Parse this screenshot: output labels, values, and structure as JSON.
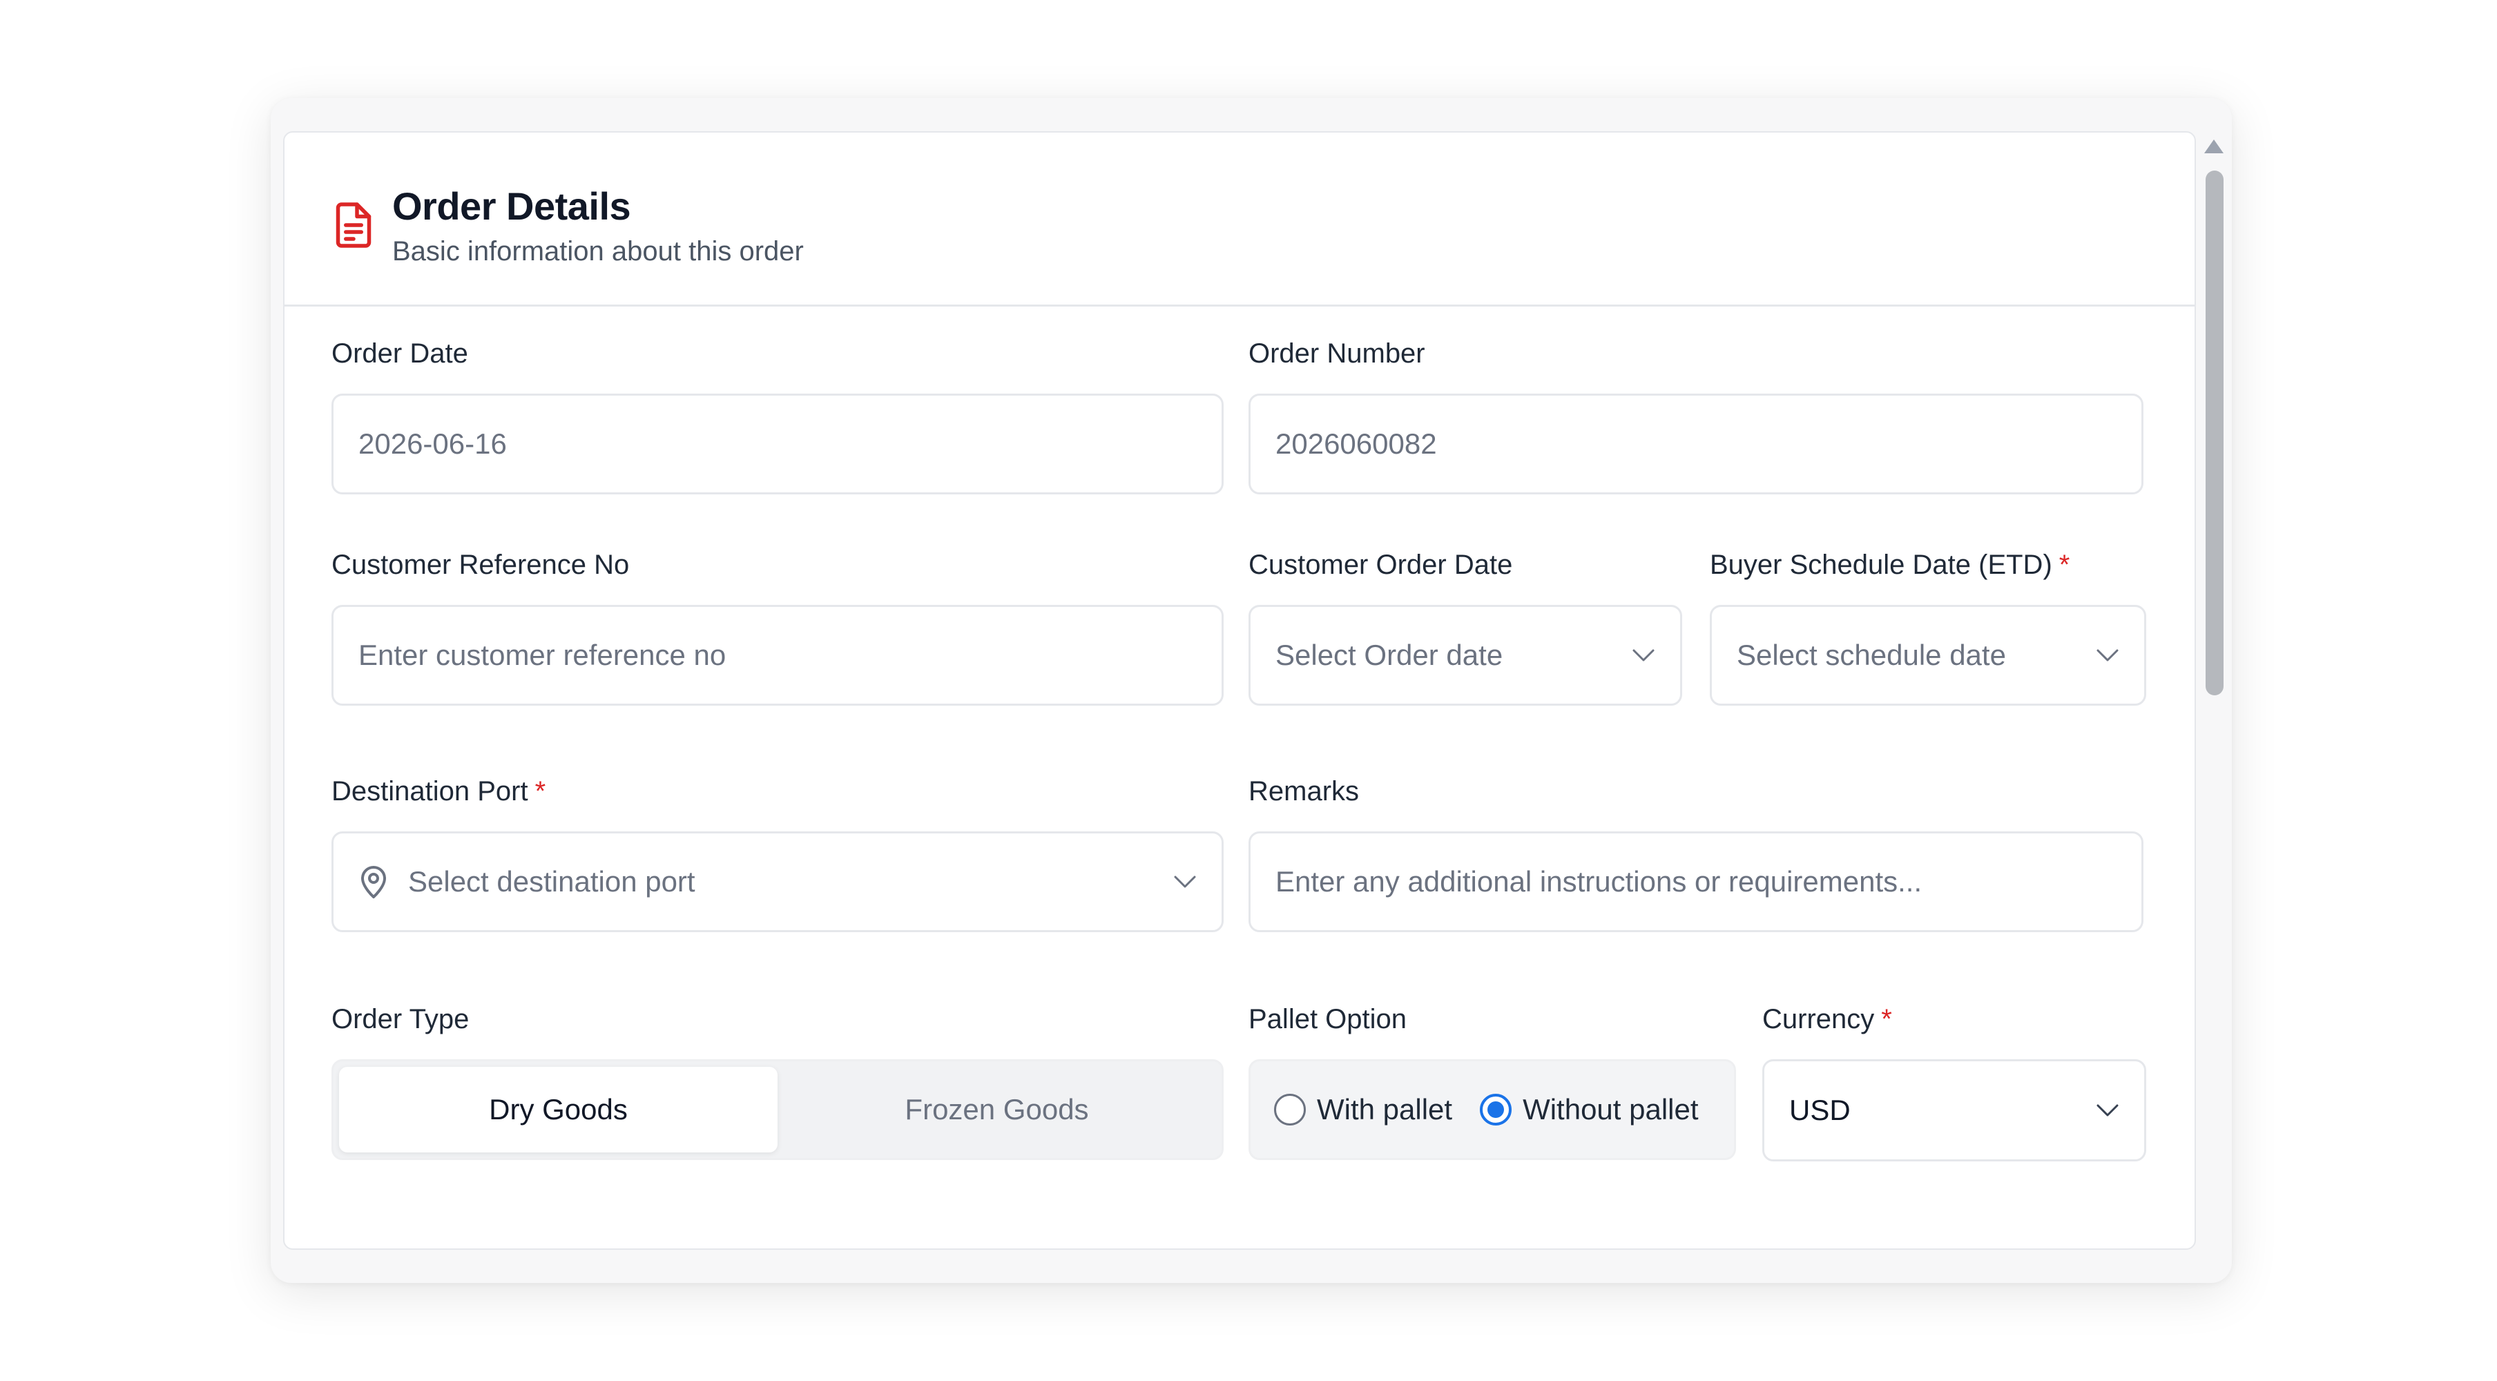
{
  "header": {
    "icon": "document-icon",
    "title": "Order Details",
    "subtitle": "Basic information about this order"
  },
  "order_date": {
    "label": "Order Date",
    "value": "2026-06-16"
  },
  "order_number": {
    "label": "Order Number",
    "value": "2026060082"
  },
  "customer_reference": {
    "label": "Customer Reference No",
    "placeholder": "Enter customer reference no"
  },
  "customer_order_date": {
    "label": "Customer Order Date",
    "placeholder": "Select Order date"
  },
  "buyer_schedule_date": {
    "label": "Buyer Schedule Date (ETD)",
    "required": "*",
    "placeholder": "Select schedule date"
  },
  "destination_port": {
    "label": "Destination Port",
    "required": "*",
    "placeholder": "Select destination port",
    "icon": "map-pin-icon"
  },
  "remarks": {
    "label": "Remarks",
    "placeholder": "Enter any additional instructions or requirements..."
  },
  "order_type": {
    "label": "Order Type",
    "options": [
      "Dry Goods",
      "Frozen Goods"
    ],
    "selected": "Dry Goods"
  },
  "pallet_option": {
    "label": "Pallet Option",
    "options": [
      "With pallet",
      "Without pallet"
    ],
    "selected": "Without pallet"
  },
  "currency": {
    "label": "Currency",
    "required": "*",
    "value": "USD"
  },
  "colors": {
    "accent": "#1a73e8",
    "required": "#dc2626",
    "icon": "#dc2626"
  }
}
